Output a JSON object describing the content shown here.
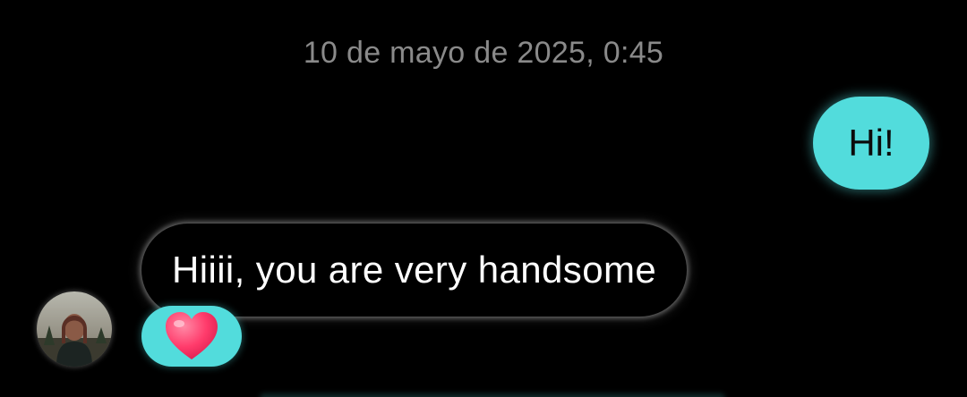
{
  "conversation": {
    "timestamp": "10 de mayo de 2025, 0:45",
    "messages": [
      {
        "direction": "outgoing",
        "text": "Hi!"
      },
      {
        "direction": "incoming",
        "text": "Hiiii, you are very handsome",
        "reaction": "❤️"
      }
    ]
  },
  "sender": {
    "avatar_icon": "profile-photo"
  },
  "colors": {
    "background": "#000000",
    "outgoing_bubble": "#52dcdc",
    "incoming_bubble_border_glow": "#ffffff",
    "timestamp_text": "#8a8a8a",
    "heart": "#ff3b6b"
  }
}
